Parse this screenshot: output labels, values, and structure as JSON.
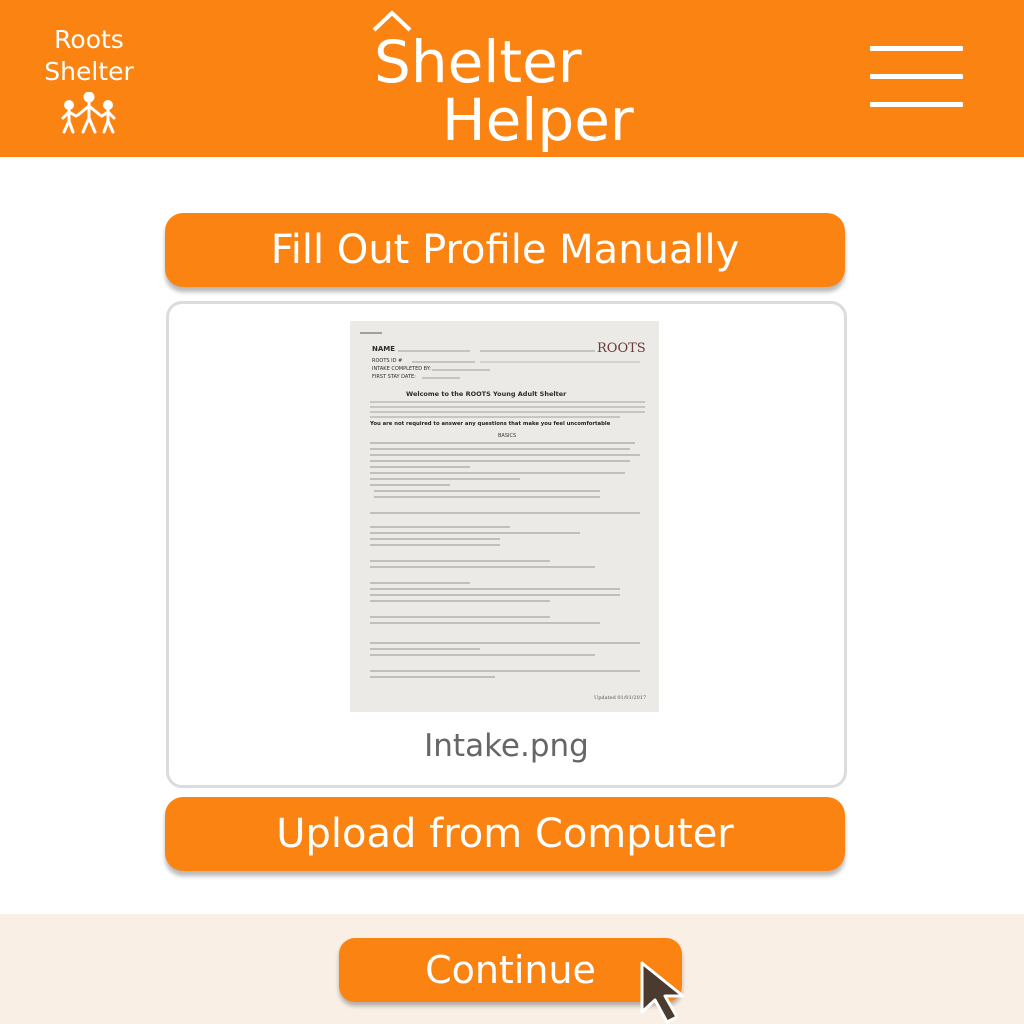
{
  "header": {
    "brand_line1": "Roots",
    "brand_line2": "Shelter",
    "brand_icon": "family-icon",
    "app_title_line1": "Shelter",
    "app_title_line2": "Helper",
    "menu_icon": "hamburger-menu-icon"
  },
  "actions": {
    "manual_label": "Fill Out Profile Manually",
    "upload_label": "Upload from Computer",
    "continue_label": "Continue"
  },
  "upload": {
    "file_name": "Intake.png",
    "preview_form": {
      "heading": "Welcome to the ROOTS Young Adult Shelter",
      "logo_text": "ROOTS",
      "fields": [
        "NAME",
        "ROOTS ID #",
        "INTAKE COMPLETED BY:",
        "FIRST STAY DATE:"
      ],
      "note": "You are not required to answer any questions that make you feel uncomfortable",
      "section": "BASICS",
      "footer": "Updated 01/01/2017"
    }
  },
  "colors": {
    "brand_orange": "#fa8312",
    "footer_background": "#faefe4",
    "card_border": "#dcdcdc",
    "filename_text": "#666666"
  }
}
